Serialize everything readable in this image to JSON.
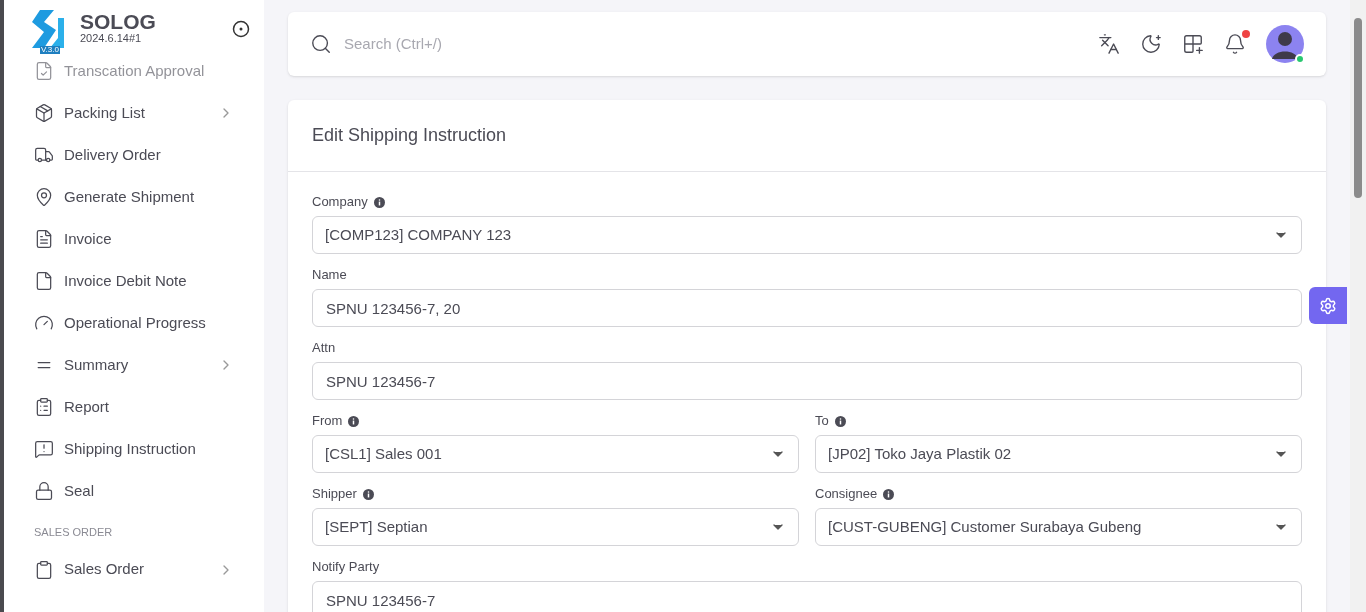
{
  "brand": {
    "name": "SOLOG",
    "version": "2024.6.14#1",
    "logo_mark": "V.3.0"
  },
  "sidebar": {
    "sections": [
      {
        "items": [
          {
            "label": "Transcation Approval",
            "dimmed": true,
            "expandable": false
          },
          {
            "label": "Packing List",
            "dimmed": false,
            "expandable": true
          },
          {
            "label": "Delivery Order",
            "dimmed": false,
            "expandable": false
          },
          {
            "label": "Generate Shipment",
            "dimmed": false,
            "expandable": false
          },
          {
            "label": "Invoice",
            "dimmed": false,
            "expandable": false
          },
          {
            "label": "Invoice Debit Note",
            "dimmed": false,
            "expandable": false
          },
          {
            "label": "Operational Progress",
            "dimmed": false,
            "expandable": false
          },
          {
            "label": "Summary",
            "dimmed": false,
            "expandable": true
          },
          {
            "label": "Report",
            "dimmed": false,
            "expandable": false
          },
          {
            "label": "Shipping Instruction",
            "dimmed": false,
            "expandable": false
          },
          {
            "label": "Seal",
            "dimmed": false,
            "expandable": false
          }
        ]
      },
      {
        "heading": "SALES ORDER",
        "items": [
          {
            "label": "Sales Order",
            "dimmed": false,
            "expandable": true
          }
        ]
      }
    ]
  },
  "topbar": {
    "search": {
      "placeholder": "Search (Ctrl+/)"
    },
    "notifications_unread": true,
    "user_online": true
  },
  "form": {
    "title": "Edit Shipping Instruction",
    "rows": [
      [
        {
          "label": "Company",
          "info": true,
          "kind": "select",
          "value": "[COMP123] COMPANY 123"
        }
      ],
      [
        {
          "label": "Name",
          "info": false,
          "kind": "text",
          "value": "SPNU 123456-7, 20"
        }
      ],
      [
        {
          "label": "Attn",
          "info": false,
          "kind": "text",
          "value": "SPNU 123456-7"
        }
      ],
      [
        {
          "label": "From",
          "info": true,
          "kind": "select",
          "value": "[CSL1] Sales 001"
        },
        {
          "label": "To",
          "info": true,
          "kind": "select",
          "value": "[JP02] Toko Jaya Plastik 02"
        }
      ],
      [
        {
          "label": "Shipper",
          "info": true,
          "kind": "select",
          "value": "[SEPT] Septian"
        },
        {
          "label": "Consignee",
          "info": true,
          "kind": "select",
          "value": "[CUST-GUBENG] Customer Surabaya Gubeng"
        }
      ],
      [
        {
          "label": "Notify Party",
          "info": false,
          "kind": "text",
          "value": "SPNU 123456-7"
        }
      ]
    ]
  }
}
